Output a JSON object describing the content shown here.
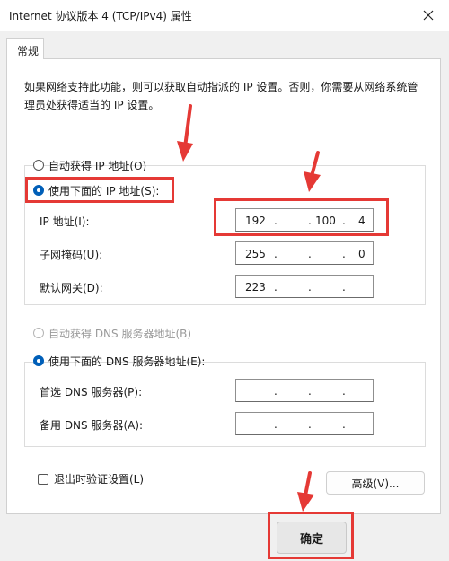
{
  "window": {
    "title": "Internet 协议版本 4 (TCP/IPv4) 属性"
  },
  "tab": {
    "label": "常规"
  },
  "intro": "如果网络支持此功能，则可以获取自动指派的 IP 设置。否则，你需要从网络系统管理员处获得适当的 IP 设置。",
  "ip": {
    "auto_label": "自动获得 IP 地址(O)",
    "manual_label": "使用下面的 IP 地址(S):",
    "fields": [
      {
        "label": "IP 地址(I):",
        "a": "192",
        "b": "",
        "c": "100",
        "d": "4"
      },
      {
        "label": "子网掩码(U):",
        "a": "255",
        "b": "",
        "c": "",
        "d": "0"
      },
      {
        "label": "默认网关(D):",
        "a": "223",
        "b": "",
        "c": "",
        "d": ""
      }
    ]
  },
  "dns": {
    "auto_label": "自动获得 DNS 服务器地址(B)",
    "manual_label": "使用下面的 DNS 服务器地址(E):",
    "fields": [
      {
        "label": "首选 DNS 服务器(P):",
        "a": "",
        "b": "",
        "c": "",
        "d": ""
      },
      {
        "label": "备用 DNS 服务器(A):",
        "a": "",
        "b": "",
        "c": "",
        "d": ""
      }
    ]
  },
  "validate_label": "退出时验证设置(L)",
  "advanced_label": "高级(V)...",
  "ok_label": "确定",
  "colors": {
    "highlight": "#e53935",
    "accent": "#005fb8"
  }
}
